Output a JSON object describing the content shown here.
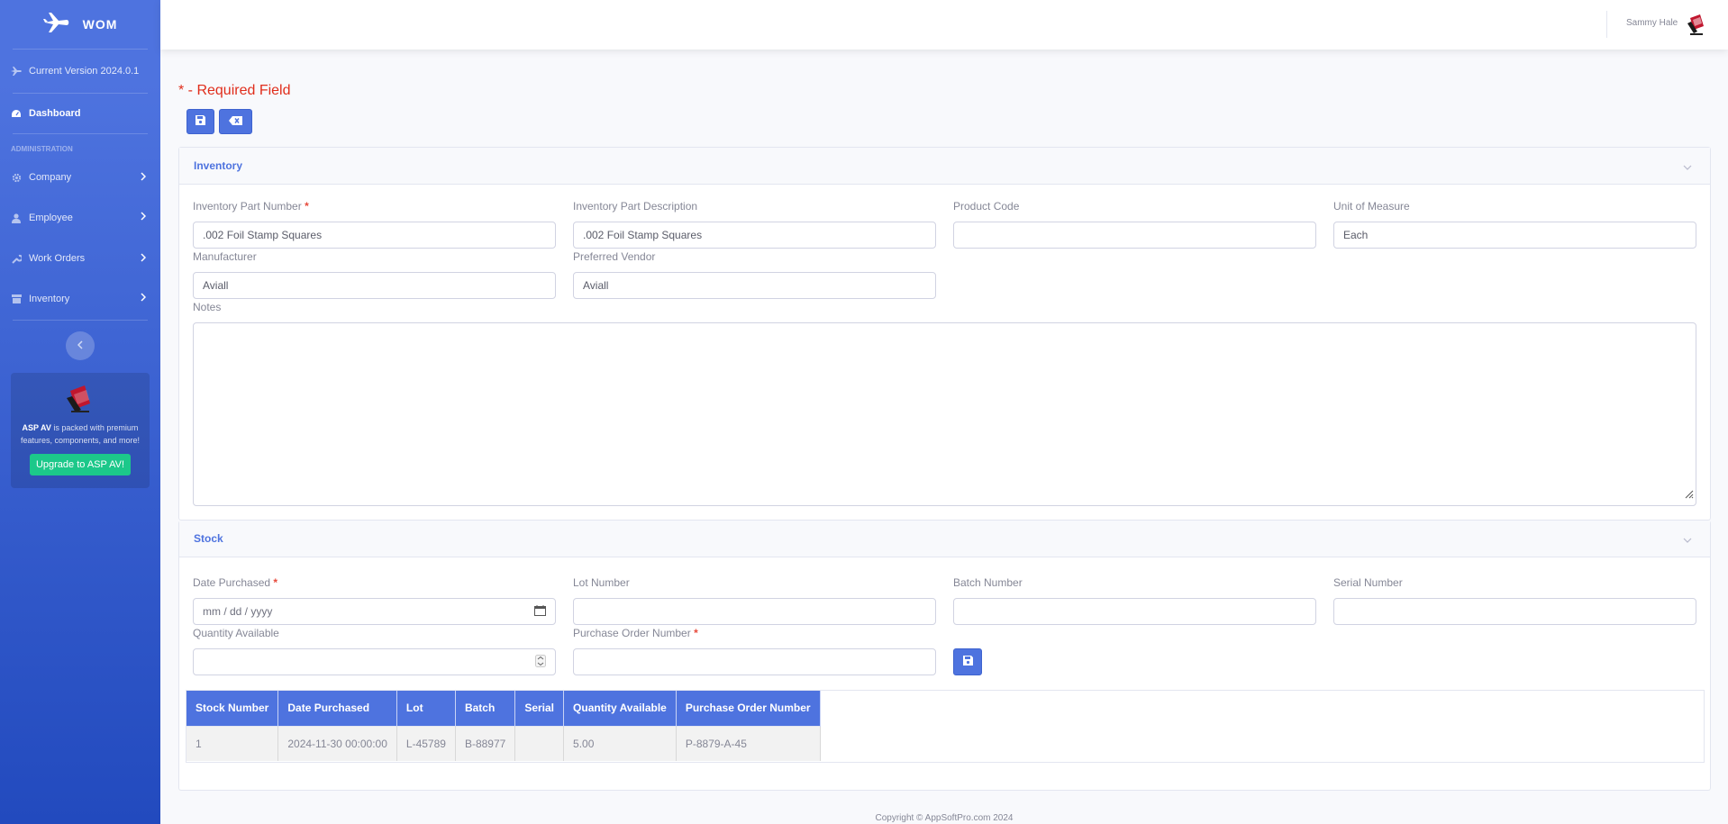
{
  "sidebar": {
    "brand": "WOM",
    "version": "Current Version 2024.0.1",
    "dashboard": "Dashboard",
    "heading": "Administration",
    "items": [
      {
        "label": "Company"
      },
      {
        "label": "Employee"
      },
      {
        "label": "Work Orders"
      },
      {
        "label": "Inventory"
      }
    ],
    "promo": {
      "product": "ASP AV",
      "text": " is packed with premium features, components, and more!",
      "button": "Upgrade to ASP AV!"
    }
  },
  "topbar": {
    "user_name": "Sammy Hale"
  },
  "form": {
    "required_note": "* - Required Field"
  },
  "inventory": {
    "title": "Inventory",
    "part_number_label": "Inventory Part Number",
    "part_number_value": ".002 Foil Stamp Squares",
    "description_label": "Inventory Part Description",
    "description_value": ".002 Foil Stamp Squares",
    "product_code_label": "Product Code",
    "product_code_value": "",
    "uom_label": "Unit of Measure",
    "uom_value": "Each",
    "manufacturer_label": "Manufacturer",
    "manufacturer_value": "Aviall",
    "vendor_label": "Preferred Vendor",
    "vendor_value": "Aviall",
    "notes_label": "Notes",
    "required_mark": "*"
  },
  "stock": {
    "title": "Stock",
    "date_label": "Date Purchased",
    "date_placeholder": "mm / dd / yyyy",
    "lot_label": "Lot Number",
    "batch_label": "Batch Number",
    "serial_label": "Serial Number",
    "qty_label": "Quantity Available",
    "po_label": "Purchase Order Number",
    "required_mark": "*",
    "table": {
      "headers": [
        "Stock Number",
        "Date Purchased",
        "Lot",
        "Batch",
        "Serial",
        "Quantity Available",
        "Purchase Order Number"
      ],
      "rows": [
        [
          "1",
          "2024-11-30 00:00:00",
          "L-45789",
          "B-88977",
          "",
          "5.00",
          "P-8879-A-45"
        ]
      ]
    }
  },
  "footer": {
    "copyright": "Copyright © AppSoftPro.com 2024"
  },
  "colors": {
    "primary": "#4e73df",
    "success": "#1cc88a",
    "danger": "#e02d1b"
  }
}
